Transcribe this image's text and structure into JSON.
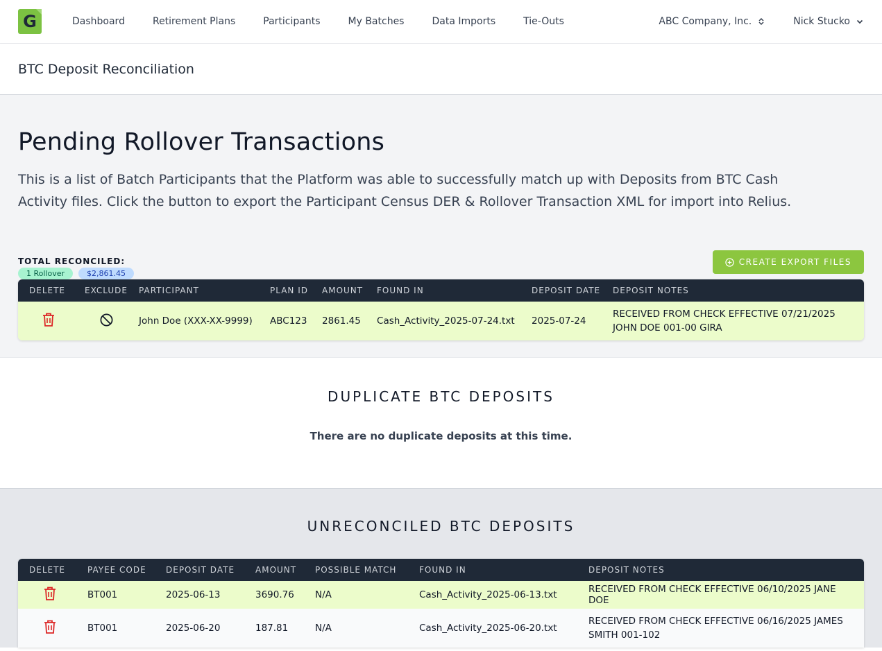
{
  "nav": {
    "logo_letter": "G",
    "links": [
      "Dashboard",
      "Retirement Plans",
      "Participants",
      "My Batches",
      "Data Imports",
      "Tie-Outs"
    ],
    "company": "ABC Company, Inc.",
    "user": "Nick Stucko"
  },
  "page_title": "BTC Deposit Reconciliation",
  "pending": {
    "heading": "Pending Rollover Transactions",
    "description": "This is a list of Batch Participants that the Platform was able to successfully match up with Deposits from BTC Cash Activity files. Click the button to export the Participant Census DER & Rollover Transaction XML for import into Relius.",
    "total_label": "TOTAL RECONCILED:",
    "badge_count": "1 Rollover",
    "badge_amount": "$2,861.45",
    "export_label": "CREATE EXPORT FILES",
    "columns": [
      "DELETE",
      "EXCLUDE",
      "PARTICIPANT",
      "PLAN ID",
      "AMOUNT",
      "FOUND IN",
      "DEPOSIT DATE",
      "DEPOSIT NOTES"
    ],
    "rows": [
      {
        "participant": "John Doe (XXX-XX-9999)",
        "plan_id": "ABC123",
        "amount": "2861.45",
        "found_in": "Cash_Activity_2025-07-24.txt",
        "deposit_date": "2025-07-24",
        "notes": "RECEIVED FROM CHECK EFFECTIVE 07/21/2025 JOHN DOE 001-00 GIRA"
      }
    ]
  },
  "duplicate": {
    "title": "DUPLICATE BTC DEPOSITS",
    "empty_text": "There are no duplicate deposits at this time."
  },
  "unreconciled": {
    "title": "UNRECONCILED BTC DEPOSITS",
    "columns": [
      "DELETE",
      "PAYEE CODE",
      "DEPOSIT DATE",
      "AMOUNT",
      "POSSIBLE MATCH",
      "FOUND IN",
      "DEPOSIT NOTES"
    ],
    "rows": [
      {
        "payee": "BT001",
        "deposit_date": "2025-06-13",
        "amount": "3690.76",
        "match": "N/A",
        "found_in": "Cash_Activity_2025-06-13.txt",
        "notes": "RECEIVED FROM CHECK EFFECTIVE 06/10/2025 JANE DOE"
      },
      {
        "payee": "BT001",
        "deposit_date": "2025-06-20",
        "amount": "187.81",
        "match": "N/A",
        "found_in": "Cash_Activity_2025-06-20.txt",
        "notes": "RECEIVED FROM CHECK EFFECTIVE 06/16/2025 JAMES SMITH 001-102"
      }
    ]
  },
  "colors": {
    "accent_green": "#8cc63f",
    "header_dark": "#1f2937",
    "row_highlight": "#ecfccb",
    "trash_red": "#dc2626"
  }
}
